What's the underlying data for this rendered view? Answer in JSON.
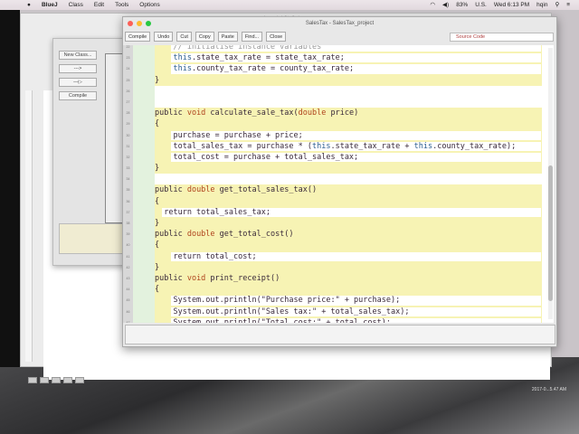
{
  "menubar": {
    "app": "BlueJ",
    "items": [
      "Class",
      "Edit",
      "Tools",
      "Options"
    ],
    "battery": "83%",
    "input": "U.S.",
    "clock": "Wed 6:13 PM",
    "user": "hqin"
  },
  "word": {
    "title": "java_lab0to2.docx"
  },
  "bluej": {
    "buttons": [
      "New Class...",
      "--->",
      "—▷",
      "Compile"
    ]
  },
  "editor": {
    "title": "SalesTax - SalesTax_project",
    "toolbar": [
      "Compile",
      "Undo",
      "Cut",
      "Copy",
      "Paste",
      "Find...",
      "Close"
    ],
    "view": "Source Code"
  },
  "desktop": {
    "clock": "2017-0...5.47 AM"
  },
  "colors": {
    "keyword": "#b0441d",
    "this": "#2d5f8f",
    "method_bg": "#f7f3b4",
    "class_bg": "#e3f2de"
  },
  "code": [
    {
      "n": "22",
      "bg": "body",
      "indent": 4,
      "tokens": [
        [
          "// initialise instance variables",
          "c"
        ]
      ]
    },
    {
      "n": "23",
      "bg": "body",
      "indent": 4,
      "tokens": [
        [
          "this",
          "t"
        ],
        [
          ".state_tax_rate = state_tax_rate;",
          "s"
        ]
      ]
    },
    {
      "n": "24",
      "bg": "body",
      "indent": 4,
      "tokens": [
        [
          "this",
          "t"
        ],
        [
          ".county_tax_rate = county_tax_rate;",
          "s"
        ]
      ]
    },
    {
      "n": "25",
      "bg": "method",
      "indent": 0,
      "tokens": [
        [
          "}",
          "s"
        ]
      ]
    },
    {
      "n": "26",
      "bg": "blank",
      "indent": 0,
      "tokens": []
    },
    {
      "n": "27",
      "bg": "blank",
      "indent": 0,
      "tokens": []
    },
    {
      "n": "28",
      "bg": "method",
      "indent": 0,
      "tokens": [
        [
          "public ",
          "s"
        ],
        [
          "void ",
          "k"
        ],
        [
          "calculate_sale_tax(",
          "s"
        ],
        [
          "double ",
          "k"
        ],
        [
          "price)",
          "s"
        ]
      ]
    },
    {
      "n": "29",
      "bg": "method",
      "indent": 0,
      "tokens": [
        [
          "{",
          "s"
        ]
      ]
    },
    {
      "n": "30",
      "bg": "body",
      "indent": 4,
      "tokens": [
        [
          "purchase = purchase + price;",
          "s"
        ]
      ]
    },
    {
      "n": "31",
      "bg": "body",
      "indent": 4,
      "tokens": [
        [
          "total_sales_tax = purchase * (",
          "s"
        ],
        [
          "this",
          "t"
        ],
        [
          ".state_tax_rate + ",
          "s"
        ],
        [
          "this",
          "t"
        ],
        [
          ".county_tax_rate);",
          "s"
        ]
      ]
    },
    {
      "n": "32",
      "bg": "body",
      "indent": 4,
      "tokens": [
        [
          "total_cost = purchase + total_sales_tax;",
          "s"
        ]
      ]
    },
    {
      "n": "33",
      "bg": "method",
      "indent": 0,
      "tokens": [
        [
          "}",
          "s"
        ]
      ]
    },
    {
      "n": "34",
      "bg": "blank",
      "indent": 0,
      "tokens": []
    },
    {
      "n": "35",
      "bg": "method",
      "indent": 0,
      "tokens": [
        [
          "public ",
          "s"
        ],
        [
          "double ",
          "k"
        ],
        [
          "get_total_sales_tax()",
          "s"
        ]
      ]
    },
    {
      "n": "36",
      "bg": "method",
      "indent": 0,
      "tokens": [
        [
          "{",
          "s"
        ]
      ]
    },
    {
      "n": "37",
      "bg": "body",
      "indent": 2,
      "tokens": [
        [
          "return total_sales_tax;",
          "s"
        ]
      ]
    },
    {
      "n": "38",
      "bg": "method",
      "indent": 0,
      "tokens": [
        [
          "}",
          "s"
        ]
      ]
    },
    {
      "n": "39",
      "bg": "method",
      "indent": 0,
      "tokens": [
        [
          "public ",
          "s"
        ],
        [
          "double ",
          "k"
        ],
        [
          "get_total_cost()",
          "s"
        ]
      ]
    },
    {
      "n": "40",
      "bg": "method",
      "indent": 0,
      "tokens": [
        [
          "{",
          "s"
        ]
      ]
    },
    {
      "n": "41",
      "bg": "body",
      "indent": 4,
      "tokens": [
        [
          "return total_cost;",
          "s"
        ]
      ]
    },
    {
      "n": "42",
      "bg": "method",
      "indent": 0,
      "tokens": [
        [
          "}",
          "s"
        ]
      ]
    },
    {
      "n": "43",
      "bg": "method",
      "indent": 0,
      "tokens": [
        [
          "public ",
          "s"
        ],
        [
          "void ",
          "k"
        ],
        [
          "print_receipt()",
          "s"
        ]
      ]
    },
    {
      "n": "44",
      "bg": "method",
      "indent": 0,
      "tokens": [
        [
          "{",
          "s"
        ]
      ]
    },
    {
      "n": "45",
      "bg": "body",
      "indent": 4,
      "tokens": [
        [
          "System.out.println(\"Purchase price:\" + purchase);",
          "s"
        ]
      ]
    },
    {
      "n": "46",
      "bg": "body",
      "indent": 4,
      "tokens": [
        [
          "System.out.println(\"Sales tax:\" + total_sales_tax);",
          "s"
        ]
      ]
    },
    {
      "n": "47",
      "bg": "body",
      "indent": 4,
      "tokens": [
        [
          "System.out.println(\"Total cost:\" + total_cost);",
          "s"
        ]
      ]
    }
  ]
}
